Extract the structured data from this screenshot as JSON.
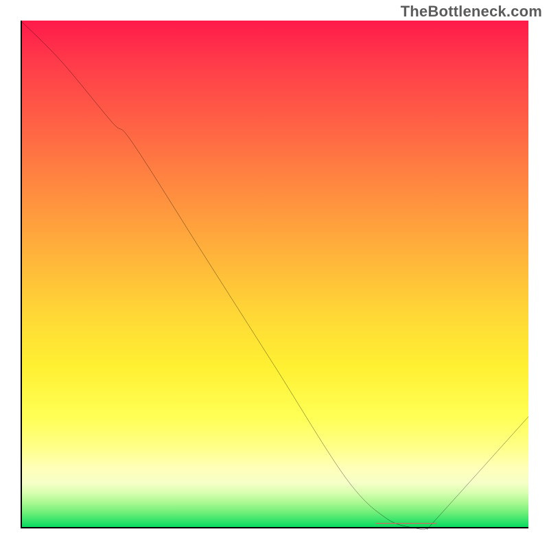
{
  "attribution": "TheBottleneck.com",
  "chart_data": {
    "type": "line",
    "title": "",
    "xlabel": "",
    "ylabel": "",
    "xlim": [
      0,
      100
    ],
    "ylim": [
      0,
      100
    ],
    "series": [
      {
        "name": "curve",
        "x": [
          0,
          8,
          18,
          22,
          36,
          50,
          64,
          72,
          78,
          80,
          82,
          100
        ],
        "y": [
          100,
          92,
          80,
          76,
          54,
          32,
          10,
          2,
          0,
          0,
          2,
          22
        ]
      }
    ],
    "marker": {
      "name": "highlight-segment",
      "x": [
        70,
        82
      ],
      "y": [
        1,
        1
      ],
      "color": "#d9645e"
    },
    "gradient_stops": [
      {
        "pos": 0.0,
        "color": "#ff1a4a"
      },
      {
        "pos": 0.38,
        "color": "#ff9a3e"
      },
      {
        "pos": 0.78,
        "color": "#ffff55"
      },
      {
        "pos": 1.0,
        "color": "#00d85e"
      }
    ]
  }
}
